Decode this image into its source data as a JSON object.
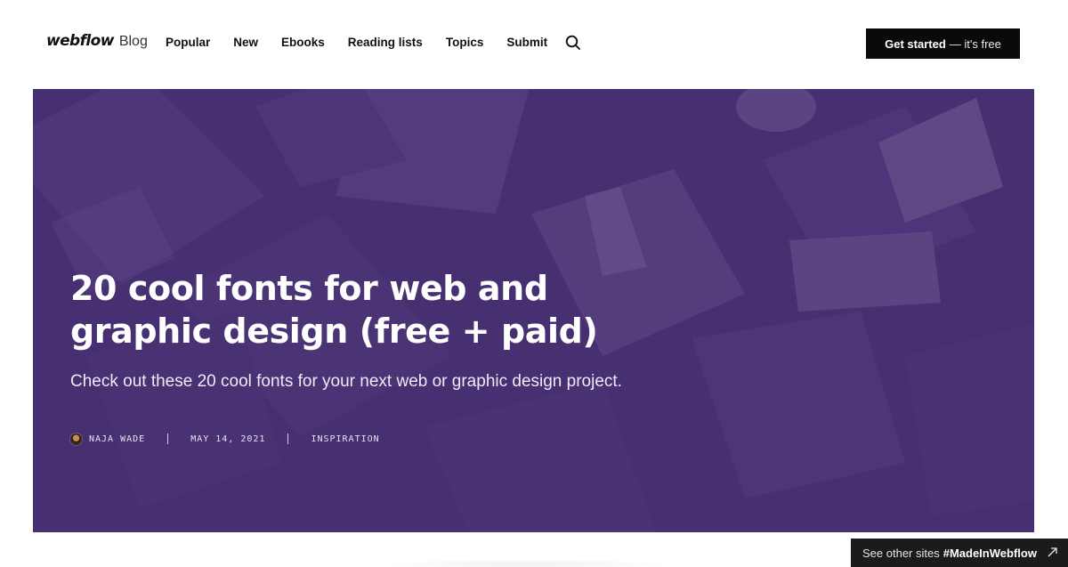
{
  "brand": {
    "logo_text": "webflow",
    "sub_text": "Blog"
  },
  "nav": {
    "items": [
      {
        "label": "Popular"
      },
      {
        "label": "New"
      },
      {
        "label": "Ebooks"
      },
      {
        "label": "Reading lists"
      },
      {
        "label": "Topics"
      },
      {
        "label": "Submit"
      }
    ],
    "search_icon": "search-icon"
  },
  "cta": {
    "main": "Get started",
    "sub": "— it's free"
  },
  "hero": {
    "title": "20 cool fonts for web and graphic design (free + paid)",
    "subtitle": "Check out these 20 cool fonts for your next web or graphic design project.",
    "author": "NAJA WADE",
    "date": "MAY 14, 2021",
    "category": "INSPIRATION",
    "overlay_color": "#4a3477"
  },
  "badge": {
    "prefix": "See other sites",
    "tag": "#MadeInWebflow",
    "icon": "external-arrow-icon"
  }
}
